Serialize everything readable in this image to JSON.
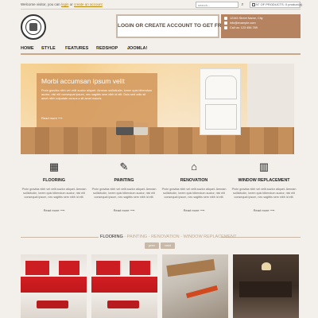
{
  "topbar": {
    "welcome": "Welcome visitor, you can",
    "login": "login",
    "or": "or",
    "create_account": "create an account",
    "search_placeholder": "search...",
    "cart": "N° OF PRODUCTS: 0 product(s)"
  },
  "header": {
    "login_banner": "LOGIN OR CREATE ACCOUNT TO GET FREE QUOTE",
    "contact": [
      "12345 Street Name, City",
      "info@example.com",
      "Call us: 123 456 789"
    ]
  },
  "nav": {
    "items": [
      {
        "label": "HOME",
        "dropdown": false
      },
      {
        "label": "STYLE",
        "dropdown": true
      },
      {
        "label": "FEATURES",
        "dropdown": true
      },
      {
        "label": "REDSHOP",
        "dropdown": true
      },
      {
        "label": "JOOMLA!",
        "dropdown": true
      }
    ],
    "caret": "▾"
  },
  "hero": {
    "title": "Morbi accumsan ipsum velit",
    "text": "Proin gravida nibh vel velit auctor aliquet. Aenean sollicitudin, lorem quis bibendum auctor, nisi elit consequat ipsum, nec sagittis sem nibh id elit. Duis sed odio sit amet nibh vulputate cursus a sit amet mauris.",
    "more": "Read more  ⟶"
  },
  "services": [
    {
      "title": "FLOORING",
      "icon": "flooring-icon",
      "glyph": "▦",
      "desc": "Proin gravida nibh vel velit auctor aliquet. Aenean sollicitudin, lorem quis bibendum auctor, nisi elit consequat ipsum, nec sagittis sem nibh id elit.",
      "more": "Read more  ⟶"
    },
    {
      "title": "PAINTING",
      "icon": "paint-brush-icon",
      "glyph": "✎",
      "desc": "Proin gravida nibh vel velit auctor aliquet. Aenean sollicitudin, lorem quis bibendum auctor, nisi elit consequat ipsum, nec sagittis sem nibh id elit.",
      "more": "Read more  ⟶"
    },
    {
      "title": "RENOVATION",
      "icon": "house-icon",
      "glyph": "⌂",
      "desc": "Proin gravida nibh vel velit auctor aliquet. Aenean sollicitudin, lorem quis bibendum auctor, nisi elit consequat ipsum, nec sagittis sem nibh id elit.",
      "more": "Read more  ⟶"
    },
    {
      "title": "WINDOW REPLACEMENT",
      "icon": "window-icon",
      "glyph": "▥",
      "desc": "Proin gravida nibh vel velit auctor aliquet. Aenean sollicitudin, lorem quis bibendum auctor, nisi elit consequat ipsum, nec sagittis sem nibh id elit.",
      "more": "Read more  ⟶"
    }
  ],
  "filter": {
    "active": "FLOORING",
    "rest": " - PAINTING - RENOVATION - WINDOW REPLACEMENT",
    "prev": "prev",
    "next": "next"
  },
  "colors": {
    "accent": "#b5835f",
    "hero_box": "#d2965a",
    "background": "#f3efea"
  }
}
